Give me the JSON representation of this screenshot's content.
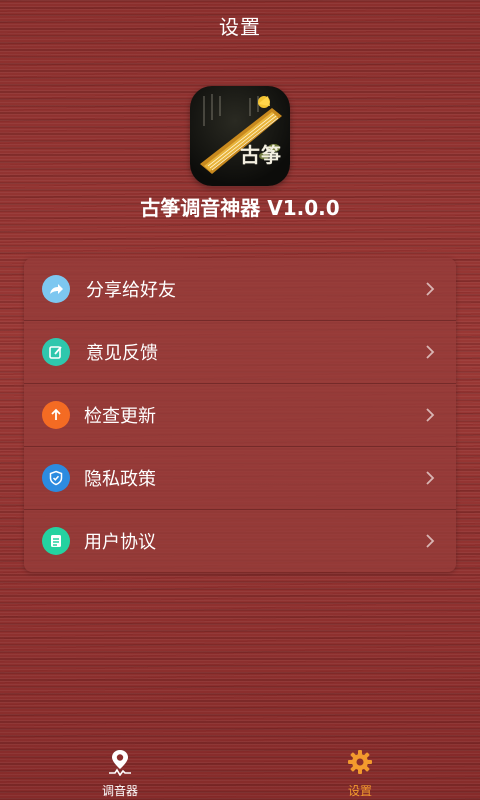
{
  "header": {
    "title": "设置"
  },
  "app": {
    "icon_text": "古筝",
    "name": "古筝调音神器 V1.0.0"
  },
  "menu": {
    "items": [
      {
        "label": "分享给好友",
        "icon": "share-icon",
        "color": "#7dc7f0"
      },
      {
        "label": "意见反馈",
        "icon": "feedback-icon",
        "color": "#2fc7ad"
      },
      {
        "label": "检查更新",
        "icon": "update-icon",
        "color": "#f46b23"
      },
      {
        "label": "隐私政策",
        "icon": "privacy-shield-icon",
        "color": "#2c8be0"
      },
      {
        "label": "用户协议",
        "icon": "agreement-icon",
        "color": "#24d2a0"
      }
    ]
  },
  "tabbar": {
    "tuner_label": "调音器",
    "settings_label": "设置",
    "active_color": "#f39a2d"
  }
}
